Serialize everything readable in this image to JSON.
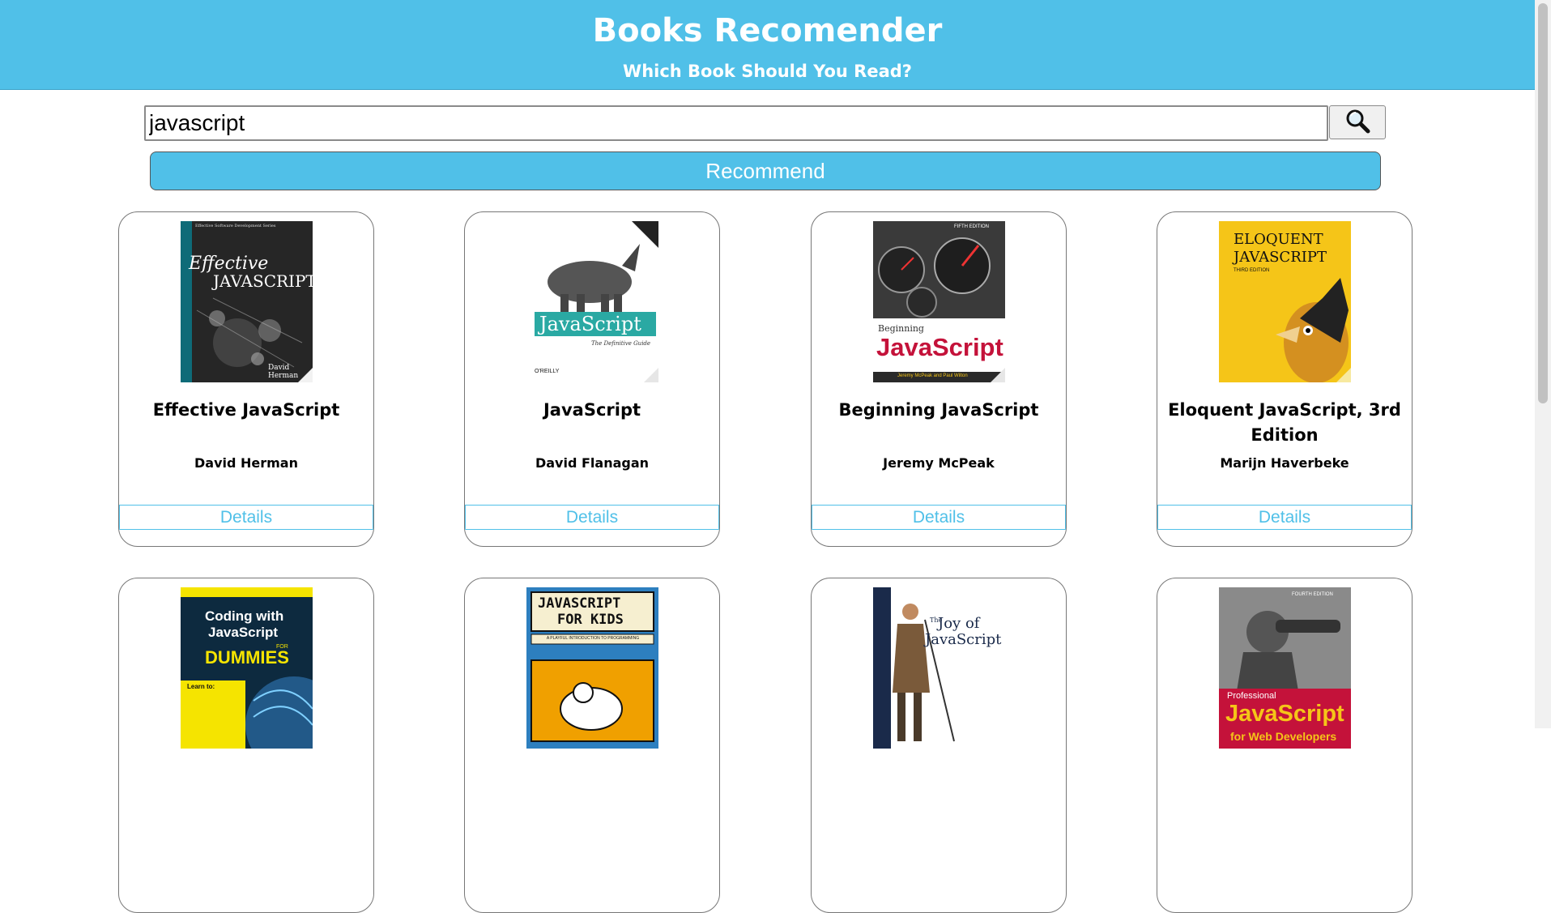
{
  "header": {
    "title": "Books Recomender",
    "subtitle": "Which Book Should You Read?"
  },
  "search": {
    "value": "javascript",
    "icon": "magnifier-icon"
  },
  "recommend_label": "Recommend",
  "books": [
    {
      "title": "Effective JavaScript",
      "author": "David Herman",
      "details_label": "Details",
      "cover_color": "#2a2a2a"
    },
    {
      "title": "JavaScript",
      "author": "David Flanagan",
      "details_label": "Details",
      "cover_color": "#ffffff"
    },
    {
      "title": "Beginning JavaScript",
      "author": "Jeremy McPeak",
      "details_label": "Details",
      "cover_color": "#3a3a3a"
    },
    {
      "title": "Eloquent JavaScript, 3rd Edition",
      "author": "Marijn Haverbeke",
      "details_label": "Details",
      "cover_color": "#f5c518"
    },
    {
      "title": "",
      "author": "",
      "details_label": "",
      "cover_color": "#0d2a3f"
    },
    {
      "title": "",
      "author": "",
      "details_label": "",
      "cover_color": "#f0a000"
    },
    {
      "title": "",
      "author": "",
      "details_label": "",
      "cover_color": "#ffffff"
    },
    {
      "title": "",
      "author": "",
      "details_label": "",
      "cover_color": "#888888"
    }
  ],
  "covers": {
    "effective": {
      "line1": "Effective",
      "line2": "JAVASCRIPT",
      "series": "Effective Software Development Series",
      "author": "David Herman"
    },
    "flanagan": {
      "title": "JavaScript",
      "subtitle": "The Definitive Guide",
      "publisher": "O'REILLY"
    },
    "beginning": {
      "line1": "Beginning",
      "line2": "JavaScript",
      "edition": "FIFTH EDITION",
      "authors": "Jeremy McPeak and Paul Wilton"
    },
    "eloquent": {
      "line1": "ELOQUENT",
      "line2": "JAVASCRIPT",
      "edition": "THIRD EDITION"
    },
    "dummies": {
      "line1": "Coding with",
      "line2": "JavaScript",
      "for": "FOR",
      "brand": "DUMMIES",
      "learn": "Learn to:"
    },
    "kids": {
      "line1": "JAVASCRIPT",
      "line2": "FOR KIDS",
      "tagline": "A PLAYFUL INTRODUCTION TO PROGRAMMING"
    },
    "joy": {
      "the": "The",
      "line1": "Joy of",
      "line2": "JavaScript"
    },
    "professional": {
      "edition": "FOURTH EDITION",
      "line1": "Professional",
      "line2": "JavaScript",
      "line3": "for Web Developers"
    }
  }
}
